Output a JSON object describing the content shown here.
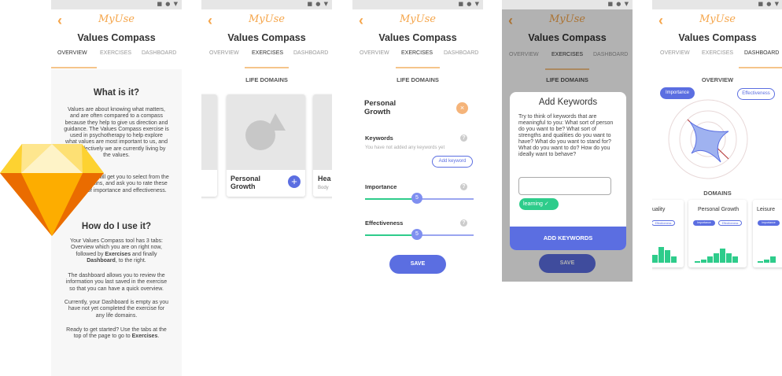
{
  "app": {
    "brand": "MyUse",
    "title": "Values Compass",
    "back_icon": "chevron-left-icon"
  },
  "status_icons": "■ ● ▼",
  "tabs": [
    "OVERVIEW",
    "EXERCISES",
    "DASHBOARD"
  ],
  "screen1": {
    "heading1": "What is it?",
    "para1": "Values are about knowing what matters, and are often compared to a compass because they help to give us direction and guidance. The Values Compass exercise is used in psychotherapy to help explore what values are most important to us, and how effectively we are currently living by the values.",
    "para2": "This exercise will get you to select from the 10 life domains, and ask you to rate these in terms of importance and effectiveness.",
    "heading2": "How do I use it?",
    "para3_a": "Your Values Compass tool has 3 tabs: Overview which you are on right now, followed by ",
    "para3_b": "Exercises",
    "para3_c": " and finally ",
    "para3_d": "Dashboard",
    "para3_e": ", to the right.",
    "para4": "The dashboard allows you to review the information you last saved in the exercise so that you can have a quick overview.",
    "para5": "Currently, your Dashboard is empty as you have not yet completed the exercise for any life domains.",
    "para6_a": "Ready to get started? Use the tabs at the top of the page to go to ",
    "para6_b": "Exercises",
    "para6_c": "."
  },
  "screen2": {
    "section": "LIFE DOMAINS",
    "card_main": "Personal Growth",
    "card_next": "Hea",
    "card_next_sub": "Body",
    "plus": "+"
  },
  "screen3": {
    "section": "LIFE DOMAINS",
    "domain": "Personal Growth",
    "close": "×",
    "keywords_label": "Keywords",
    "keywords_hint": "You have not added any keywords yet",
    "add_keyword": "Add keyword",
    "importance_label": "Importance",
    "importance_value": "5",
    "effectiveness_label": "Effectiveness",
    "effectiveness_value": "5",
    "help": "?",
    "save": "SAVE"
  },
  "screen4": {
    "section": "LIFE DOMAINS",
    "modal_title": "Add Keywords",
    "modal_text": "Try to think of keywords that are meaningful to you: What sort of person do you want to be? What sort of strengths and qualities do you want to have? What do you want to stand for? What do you want to do? How do you ideally want to behave?",
    "input_value": "",
    "chip": "learning ✓",
    "add_button": "ADD KEYWORDS",
    "save": "SAVE"
  },
  "screen5": {
    "section_overview": "OVERVIEW",
    "importance": "Importance",
    "effectiveness": "Effectiveness",
    "section_domains": "DOMAINS",
    "cards": [
      {
        "name": "uality",
        "bars": [
          5,
          10,
          8,
          4
        ]
      },
      {
        "name": "Personal Growth",
        "bars": [
          1,
          2,
          4,
          6,
          9,
          6,
          4
        ]
      },
      {
        "name": "Leisure",
        "bars": [
          1,
          2,
          4
        ]
      }
    ]
  },
  "colors": {
    "accent": "#f5a54a",
    "primary": "#5b6ee1",
    "green": "#2ecc8b"
  }
}
